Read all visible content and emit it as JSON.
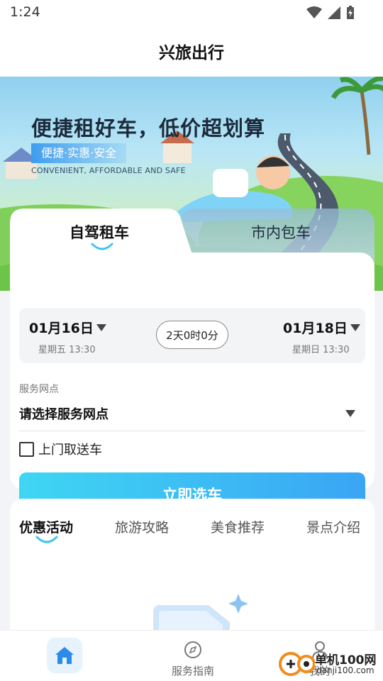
{
  "status_bar": {
    "time": "1:24"
  },
  "header": {
    "title": "兴旅出行"
  },
  "banner": {
    "headline": "便捷租好车，低价超划算",
    "tagline": "便捷·实惠·安全",
    "english": "CONVENIENT, AFFORDABLE AND SAFE"
  },
  "booking": {
    "tabs": [
      {
        "label": "自驾租车",
        "active": true
      },
      {
        "label": "市内包车",
        "active": false
      }
    ],
    "pickup": {
      "date": "01月16日",
      "detail": "星期五 13:30"
    },
    "duration": "2天0时0分",
    "return": {
      "date": "01月18日",
      "detail": "星期日 13:30"
    },
    "branch": {
      "label": "服务网点",
      "placeholder": "请选择服务网点"
    },
    "delivery": {
      "label": "上门取送车",
      "checked": false
    },
    "submit_label": "立即选车"
  },
  "info": {
    "tabs": [
      {
        "label": "优惠活动",
        "active": true
      },
      {
        "label": "旅游攻略",
        "active": false
      },
      {
        "label": "美食推荐",
        "active": false
      },
      {
        "label": "景点介绍",
        "active": false
      }
    ]
  },
  "bottom_nav": {
    "items": [
      {
        "label": "",
        "icon": "home-icon",
        "active": true
      },
      {
        "label": "服务指南",
        "icon": "compass-icon",
        "active": false
      },
      {
        "label": "我的",
        "icon": "person-icon",
        "active": false
      }
    ]
  },
  "watermark": {
    "text": "单机100网",
    "url": "danji100.com"
  },
  "colors": {
    "accent": "#3aa5f4",
    "button_start": "#3fd6f3",
    "button_end": "#3aa5f4",
    "home_icon": "#2b8be8"
  }
}
